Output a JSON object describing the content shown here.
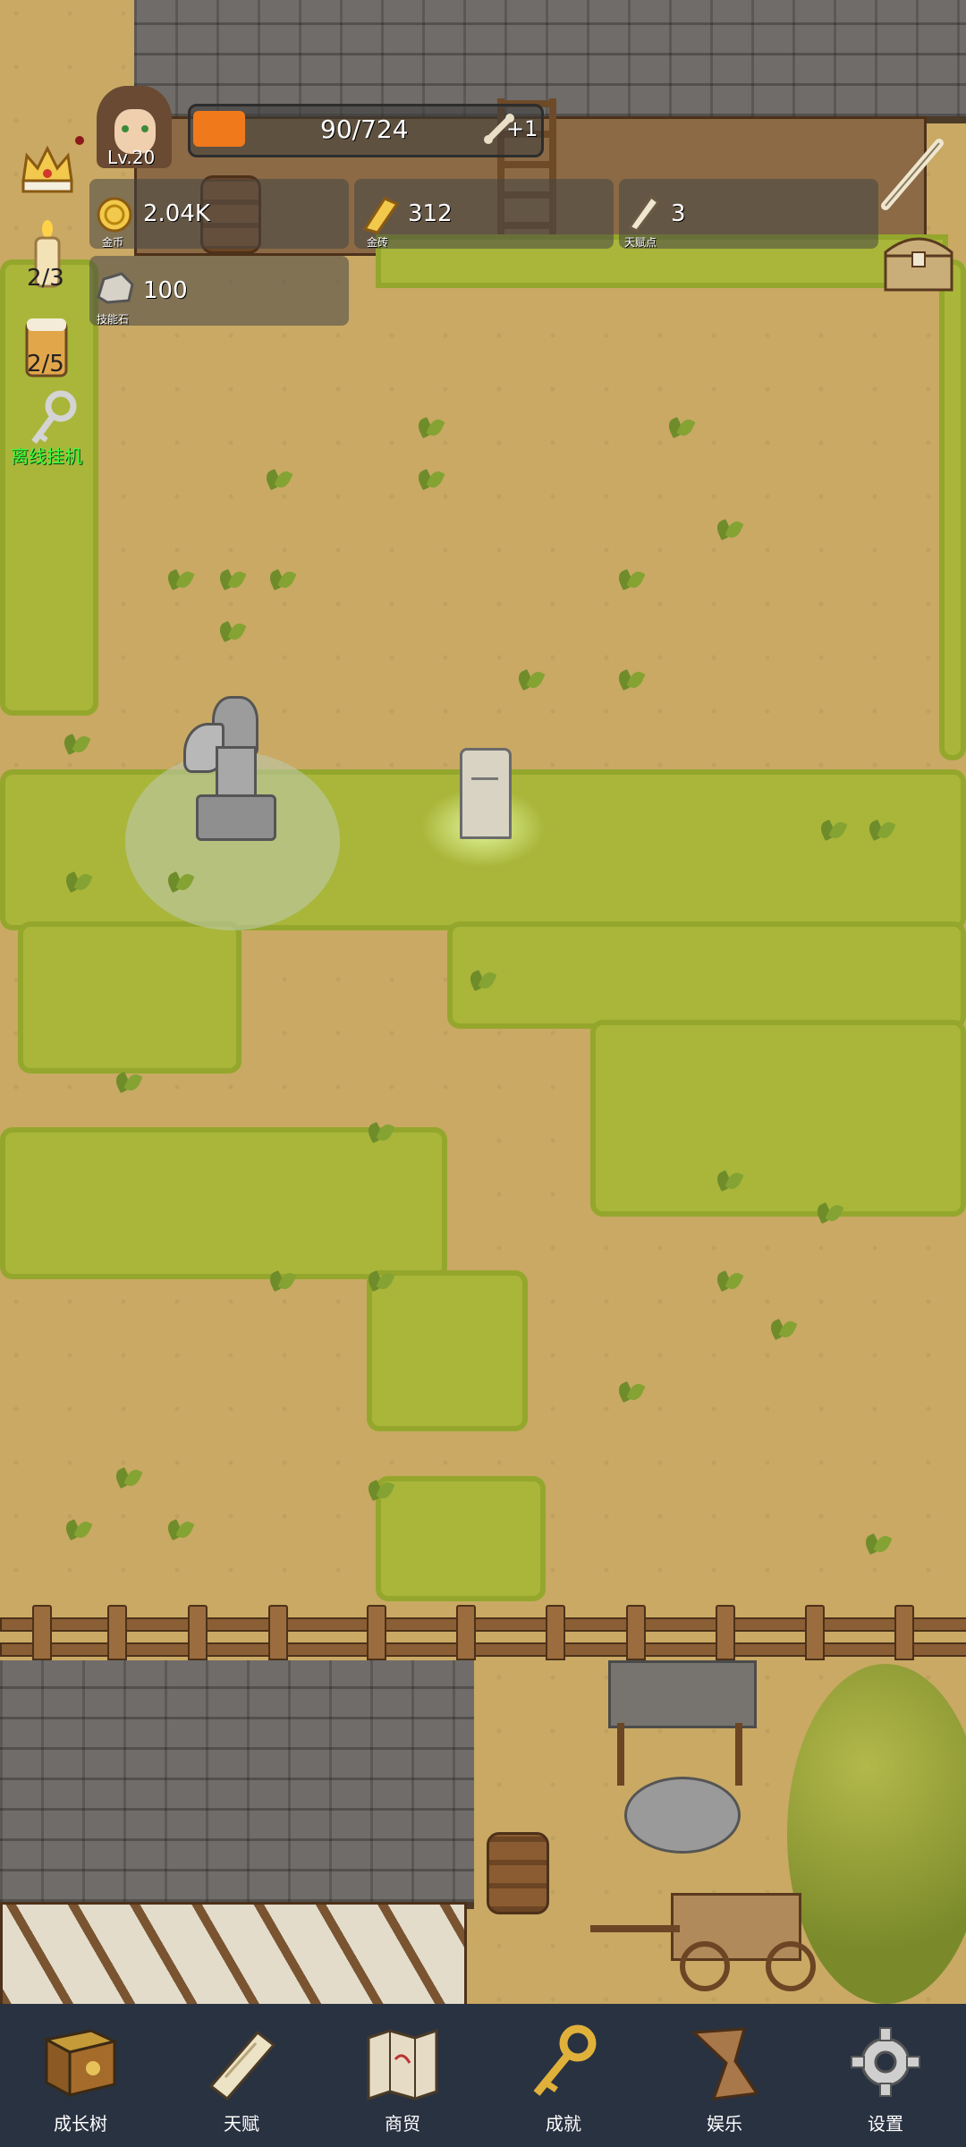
{
  "player": {
    "level": "Lv.20"
  },
  "xp_bar": {
    "value": "90/724",
    "progress": 0.124,
    "bonus": "+1"
  },
  "resources": {
    "gold": {
      "value": "2.04K",
      "label": "金币"
    },
    "gold_brick": {
      "value": "312",
      "label": "金砖"
    },
    "talent_points": {
      "value": "3",
      "label": "天赋点"
    },
    "skill_stone": {
      "value": "100",
      "label": "技能石"
    }
  },
  "side_counters": {
    "candle": "2/3",
    "beer": "2/5",
    "idle_key_label": "离线挂机"
  },
  "nav": [
    {
      "label": "成长树",
      "icon": "book-icon"
    },
    {
      "label": "天赋",
      "icon": "scroll-icon"
    },
    {
      "label": "商贸",
      "icon": "map-icon"
    },
    {
      "label": "成就",
      "icon": "key-icon"
    },
    {
      "label": "娱乐",
      "icon": "paper-icon"
    },
    {
      "label": "设置",
      "icon": "gear-icon"
    }
  ],
  "colors": {
    "grass": "#a9b63a",
    "dirt": "#c9a964",
    "nav_bg": "#293241",
    "xp_fill": "#f07a1b",
    "idle_label": "#3cff3c"
  }
}
